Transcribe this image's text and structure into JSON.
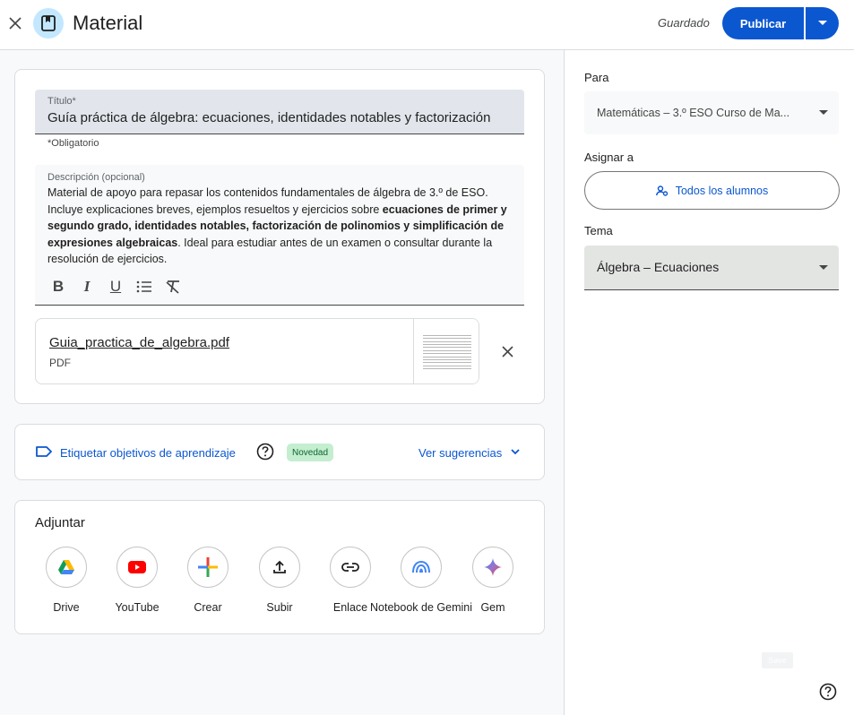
{
  "header": {
    "title": "Material",
    "saved_status": "Guardado",
    "publish_label": "Publicar"
  },
  "title_field": {
    "label": "Título*",
    "value": "Guía práctica de álgebra: ecuaciones, identidades notables y factorización",
    "required_note": "*Obligatorio"
  },
  "description": {
    "label": "Descripción (opcional)",
    "part1": "Material de apoyo para repasar los contenidos fundamentales de álgebra de 3.º de ESO. Incluye explicaciones breves, ejemplos resueltos y ejercicios sobre ",
    "part2": "ecuaciones de primer y segundo grado, identidades notables, factorización de polinomios y simplificación de expresiones algebraicas",
    "part3": ". Ideal para estudiar antes de un examen o consultar durante la resolución de ejercicios.",
    "format_buttons": [
      "B",
      "I",
      "U"
    ]
  },
  "attachment": {
    "file_name": "Guia_practica_de_algebra.pdf",
    "file_type": "PDF"
  },
  "learning_goals": {
    "link": "Etiquetar objetivos de aprendizaje",
    "badge": "Novedad",
    "suggestions": "Ver sugerencias"
  },
  "attach_section": {
    "title": "Adjuntar",
    "options": [
      {
        "label": "Drive",
        "icon": "drive-icon"
      },
      {
        "label": "YouTube",
        "icon": "youtube-icon"
      },
      {
        "label": "Crear",
        "icon": "plus-icon"
      },
      {
        "label": "Subir",
        "icon": "upload-icon"
      },
      {
        "label": "Enlace",
        "icon": "link-icon"
      },
      {
        "label": "Notebook de Gemini",
        "icon": "notebook-icon"
      },
      {
        "label": "Gem",
        "icon": "gem-icon"
      }
    ]
  },
  "right_panel": {
    "para_label": "Para",
    "para_value": "Matemáticas – 3.º ESO Curso de Ma...",
    "assign_label": "Asignar a",
    "assign_value": "Todos los alumnos",
    "tema_label": "Tema",
    "tema_value": "Álgebra – Ecuaciones",
    "save_chip": "Save"
  },
  "colors": {
    "accent": "#0b57d0",
    "badge_bg": "#c4eed0",
    "title_field_bg": "#e2e6ec"
  }
}
